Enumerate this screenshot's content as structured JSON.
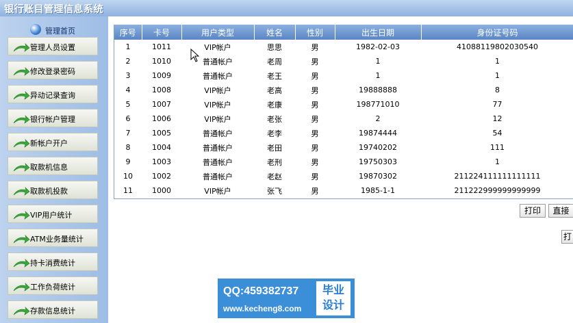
{
  "app": {
    "title": "银行账目管理信息系统"
  },
  "sidebar": {
    "home_label": "管理首页",
    "items": [
      {
        "label": "管理人员设置"
      },
      {
        "label": "修改登录密码"
      },
      {
        "label": "异动记录查询"
      },
      {
        "label": "银行帐户管理"
      },
      {
        "label": "新帐户开户"
      },
      {
        "label": "取款机信息"
      },
      {
        "label": "取款机投款"
      },
      {
        "label": "VIP用户统计"
      },
      {
        "label": "ATM业务量统计"
      },
      {
        "label": "持卡消费统计"
      },
      {
        "label": "工作负荷统计"
      },
      {
        "label": "存款信息统计"
      }
    ]
  },
  "table": {
    "headers": [
      "序号",
      "卡号",
      "用户类型",
      "姓名",
      "性别",
      "出生日期",
      "身份证号码"
    ],
    "rows": [
      [
        "1",
        "1011",
        "VIP帐户",
        "思思",
        "男",
        "1982-02-03",
        "41088119802030540"
      ],
      [
        "2",
        "1010",
        "普通帐户",
        "老周",
        "男",
        "1",
        "1"
      ],
      [
        "3",
        "1009",
        "普通帐户",
        "老王",
        "男",
        "1",
        "1"
      ],
      [
        "4",
        "1008",
        "VIP帐户",
        "老高",
        "男",
        "19888888",
        "8"
      ],
      [
        "5",
        "1007",
        "VIP帐户",
        "老康",
        "男",
        "198771010",
        "77"
      ],
      [
        "6",
        "1006",
        "VIP帐户",
        "老张",
        "男",
        "2",
        "12"
      ],
      [
        "7",
        "1005",
        "普通帐户",
        "老李",
        "男",
        "19874444",
        "54"
      ],
      [
        "8",
        "1004",
        "普通帐户",
        "老田",
        "男",
        "19740202",
        "111"
      ],
      [
        "9",
        "1003",
        "普通帐户",
        "老刑",
        "男",
        "19750303",
        "1"
      ],
      [
        "10",
        "1002",
        "普通帐户",
        "老赵",
        "男",
        "19870302",
        "211224111111111111"
      ],
      [
        "11",
        "1000",
        "VIP帐户",
        "张飞",
        "男",
        "1985-1-1",
        "211222999999999999"
      ]
    ]
  },
  "actions": {
    "print_label": "打印",
    "direct_label": "直接",
    "extra_label": "打"
  },
  "watermark": {
    "qq": "QQ:459382737",
    "site": "www.kecheng8.com",
    "badge_line1": "毕业",
    "badge_line2": "设计"
  },
  "colors": {
    "header_gradient": [
      "#bfd6f0",
      "#8fb2de"
    ],
    "table_header": "#5a86c4",
    "menu_arrow": "#3aa83a",
    "watermark_bg": "#3b8fd8"
  }
}
